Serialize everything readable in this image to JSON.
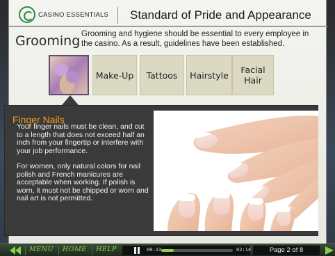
{
  "header": {
    "logo_text": "CASINO ESSENTIALS",
    "title": "Standard of Pride and Appearance"
  },
  "section": {
    "heading": "Grooming",
    "intro": "Grooming and hygiene should be essential to every employee in the casino. As a result, guidelines have been established."
  },
  "tabs": {
    "selected": "Finger Nails",
    "items": [
      {
        "label": "Make-Up"
      },
      {
        "label": "Tattoos"
      },
      {
        "label": "Hairstyle"
      },
      {
        "label_line1": "Facial",
        "label_line2": "Hair"
      }
    ]
  },
  "panel": {
    "heading": "Finger Nails",
    "paragraph1": "Your finger nails must be clean, and cut to a length that does not exceed half an inch from your fingertip or interfere with your job performance.",
    "paragraph2": "For women, only natural colors for nail polish and French manicures are acceptable when working. If polish is worn, it must not be chipped or worn and nail art is not permitted."
  },
  "player": {
    "menu_label": "MENU",
    "home_label": "HOME",
    "help_label": "HELP",
    "time_current": "00:23",
    "time_total": "02:14",
    "progress_fraction": 0.17,
    "page_indicator": "Page 2 of 8"
  },
  "colors": {
    "accent_orange": "#f0a020",
    "control_green": "#7fd24a",
    "tab_bg": "#dcd9c2",
    "panel_bg": "#3a3a3a"
  }
}
